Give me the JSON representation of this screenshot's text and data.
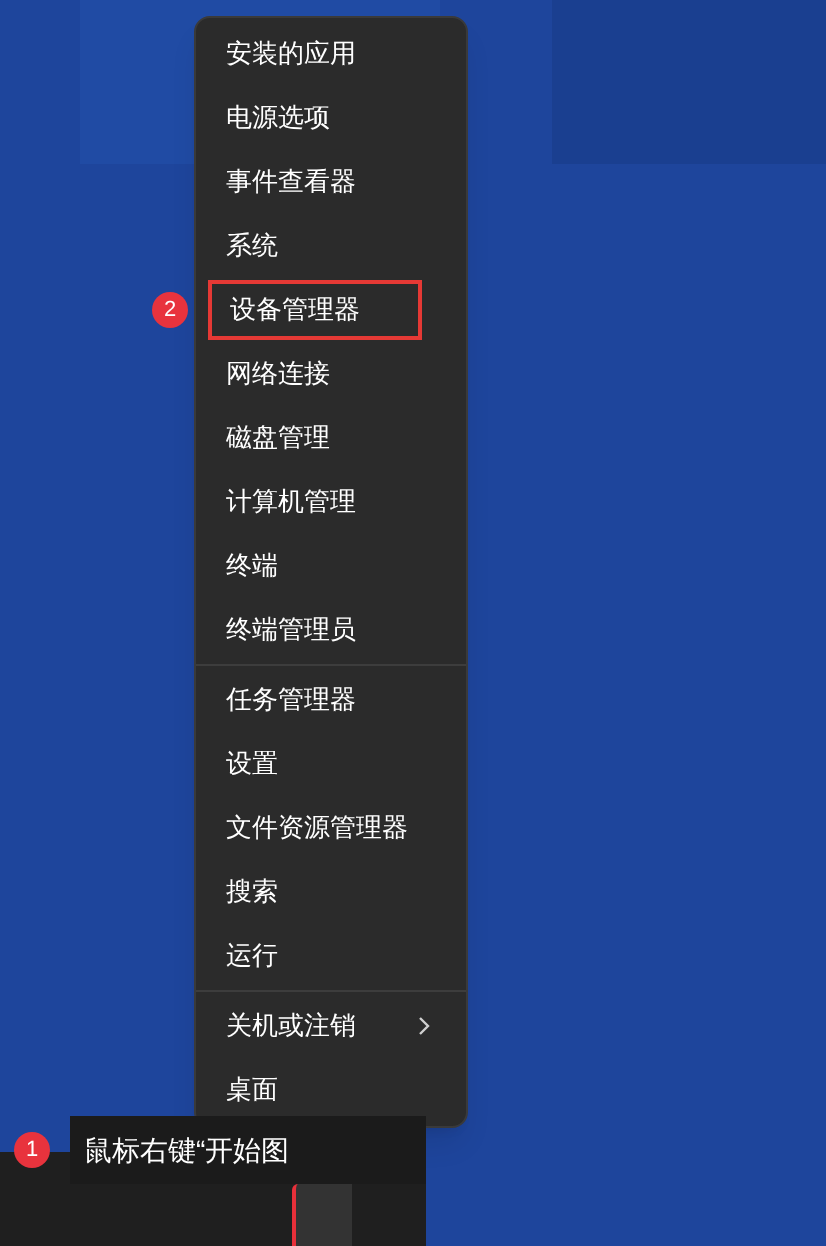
{
  "context_menu": {
    "groups": [
      [
        {
          "label": "安装的应用",
          "highlighted": false,
          "submenu": false
        },
        {
          "label": "电源选项",
          "highlighted": false,
          "submenu": false
        },
        {
          "label": "事件查看器",
          "highlighted": false,
          "submenu": false
        },
        {
          "label": "系统",
          "highlighted": false,
          "submenu": false
        },
        {
          "label": "设备管理器",
          "highlighted": true,
          "submenu": false
        },
        {
          "label": "网络连接",
          "highlighted": false,
          "submenu": false
        },
        {
          "label": "磁盘管理",
          "highlighted": false,
          "submenu": false
        },
        {
          "label": "计算机管理",
          "highlighted": false,
          "submenu": false
        },
        {
          "label": "终端",
          "highlighted": false,
          "submenu": false
        },
        {
          "label": "终端管理员",
          "highlighted": false,
          "submenu": false
        }
      ],
      [
        {
          "label": "任务管理器",
          "highlighted": false,
          "submenu": false
        },
        {
          "label": "设置",
          "highlighted": false,
          "submenu": false
        },
        {
          "label": "文件资源管理器",
          "highlighted": false,
          "submenu": false
        },
        {
          "label": "搜索",
          "highlighted": false,
          "submenu": false
        },
        {
          "label": "运行",
          "highlighted": false,
          "submenu": false
        }
      ],
      [
        {
          "label": "关机或注销",
          "highlighted": false,
          "submenu": true
        },
        {
          "label": "桌面",
          "highlighted": false,
          "submenu": false
        }
      ]
    ]
  },
  "step_badges": [
    "2",
    "1"
  ],
  "tooltip": "鼠标右键“开始图"
}
